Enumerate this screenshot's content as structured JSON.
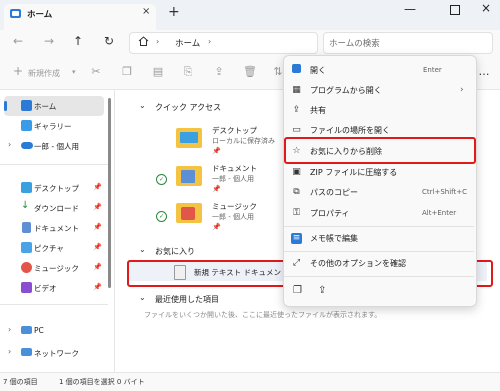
{
  "window": {
    "tab_title": "ホーム",
    "tab_close": "×",
    "new_tab": "+",
    "minimize": "—",
    "close": "×"
  },
  "nav": {
    "back": "←",
    "forward": "→",
    "up": "↑",
    "refresh": "↻",
    "address_sep": "›",
    "address_location": "ホーム",
    "search_placeholder": "ホームの検索"
  },
  "toolbar": {
    "new_icon": "+",
    "new_label": "新規作成",
    "new_chevron": "▾",
    "cut": "✂",
    "copy": "❐",
    "paste": "▤",
    "share_small": "⎘",
    "share": "⇪",
    "delete": "🗑",
    "sort": "⇅",
    "more": "…"
  },
  "sidebar": {
    "items": [
      {
        "label": "ホーム"
      },
      {
        "label": "ギャラリー"
      },
      {
        "label": "一郎 - 個人用"
      },
      {
        "label": "デスクトップ"
      },
      {
        "label": "ダウンロード"
      },
      {
        "label": "ドキュメント"
      },
      {
        "label": "ピクチャ"
      },
      {
        "label": "ミュージック"
      },
      {
        "label": "ビデオ"
      },
      {
        "label": "PC"
      },
      {
        "label": "ネットワーク"
      }
    ],
    "expand_glyph": "›",
    "pin_glyph": "📌"
  },
  "main": {
    "quick_access_title": "クイック アクセス",
    "section_chevron": "⌄",
    "quick_items": [
      {
        "name": "デスクトップ",
        "sub": "ローカルに保存済み"
      },
      {
        "name": "ドキュメント",
        "sub": "一郎 - 個人用"
      },
      {
        "name": "ミュージック",
        "sub": "一郎 - 個人用"
      }
    ],
    "check_glyph": "✓",
    "favorites_title": "お気に入り",
    "favorite_file": "新規 テキスト ドキュメント",
    "recent_title": "最近使用した項目",
    "recent_empty": "ファイルをいくつか開いた後、ここに最近使ったファイルが表示されます。"
  },
  "status": {
    "item_count": "7 個の項目",
    "selected": "1 個の項目を選択 0 バイト"
  },
  "context_menu": {
    "items": [
      {
        "label": "開く",
        "shortcut": "Enter",
        "icon": "open-icon"
      },
      {
        "label": "プログラムから開く",
        "shortcut": "›",
        "icon": "open-with-icon"
      },
      {
        "label": "共有",
        "shortcut": "",
        "icon": "share-icon"
      },
      {
        "label": "ファイルの場所を開く",
        "shortcut": "",
        "icon": "folder-icon"
      },
      {
        "label": "お気に入りから削除",
        "shortcut": "",
        "icon": "unfavorite-icon"
      },
      {
        "label": "ZIP ファイルに圧縮する",
        "shortcut": "",
        "icon": "zip-icon"
      },
      {
        "label": "パスのコピー",
        "shortcut": "Ctrl+Shift+C",
        "icon": "copy-path-icon"
      },
      {
        "label": "プロパティ",
        "shortcut": "Alt+Enter",
        "icon": "properties-icon"
      },
      {
        "label": "メモ帳で編集",
        "shortcut": "",
        "icon": "notepad-icon"
      },
      {
        "label": "その他のオプションを確認",
        "shortcut": "",
        "icon": "more-options-icon"
      }
    ],
    "bottom_icons": [
      "copy-icon",
      "share-icon"
    ]
  },
  "colors": {
    "accent": "#2b7ad6",
    "highlight_red": "#e01a1a",
    "folder_yellow": "#f5c342"
  }
}
